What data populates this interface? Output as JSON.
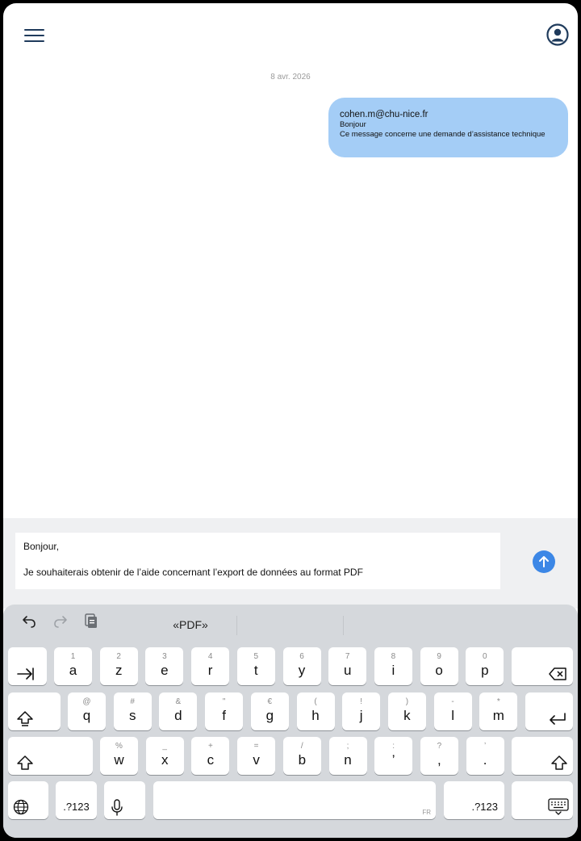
{
  "header": {
    "menu_icon": "hamburger-icon",
    "profile_icon": "user-circle-icon"
  },
  "conversation": {
    "date_separator": "8 avr. 2026",
    "messages": [
      {
        "sender": "cohen.m@chu-nice.fr",
        "lines": [
          "Bonjour",
          "Ce message concerne une demande d’assistance technique"
        ]
      }
    ]
  },
  "composer": {
    "lines": [
      "Bonjour,",
      "Je souhaiterais obtenir de l’aide concernant l’export de données au format PDF"
    ],
    "send_icon": "arrow-up-icon"
  },
  "keyboard": {
    "toolbar": {
      "undo_icon": "undo-icon",
      "redo_icon": "redo-icon",
      "paste_icon": "clipboard-icon",
      "suggestion": "«PDF»"
    },
    "row1": [
      {
        "main": "a",
        "sec": "1"
      },
      {
        "main": "z",
        "sec": "2"
      },
      {
        "main": "e",
        "sec": "3"
      },
      {
        "main": "r",
        "sec": "4"
      },
      {
        "main": "t",
        "sec": "5"
      },
      {
        "main": "y",
        "sec": "6"
      },
      {
        "main": "u",
        "sec": "7"
      },
      {
        "main": "i",
        "sec": "8"
      },
      {
        "main": "o",
        "sec": "9"
      },
      {
        "main": "p",
        "sec": "0"
      }
    ],
    "row2": [
      {
        "main": "q",
        "sec": "@"
      },
      {
        "main": "s",
        "sec": "#"
      },
      {
        "main": "d",
        "sec": "&"
      },
      {
        "main": "f",
        "sec": "\""
      },
      {
        "main": "g",
        "sec": "€"
      },
      {
        "main": "h",
        "sec": "("
      },
      {
        "main": "j",
        "sec": "!"
      },
      {
        "main": "k",
        "sec": ")"
      },
      {
        "main": "l",
        "sec": "-"
      },
      {
        "main": "m",
        "sec": "*"
      }
    ],
    "row3": [
      {
        "main": "w",
        "sec": "%"
      },
      {
        "main": "x",
        "sec": "_"
      },
      {
        "main": "c",
        "sec": "+"
      },
      {
        "main": "v",
        "sec": "="
      },
      {
        "main": "b",
        "sec": "/"
      },
      {
        "main": "n",
        "sec": ";"
      },
      {
        "main": "’",
        "sec": ":"
      },
      {
        "main": ",",
        "sec": "?"
      },
      {
        "main": ".",
        "sec": "’"
      }
    ],
    "numbers_label": ".?123",
    "space_lang_tag": "FR"
  }
}
